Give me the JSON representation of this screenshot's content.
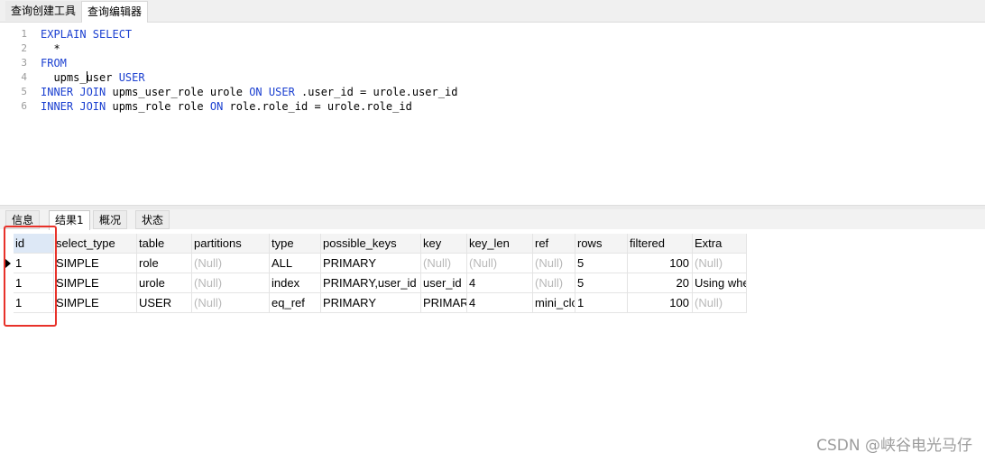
{
  "top_tabs": [
    "查询创建工具",
    "查询编辑器"
  ],
  "editor": {
    "lines": [
      {
        "num": "1",
        "tokens": [
          {
            "t": "EXPLAIN SELECT",
            "k": true
          }
        ]
      },
      {
        "num": "2",
        "tokens": [
          {
            "t": "  *",
            "k": false
          }
        ]
      },
      {
        "num": "3",
        "tokens": [
          {
            "t": "FROM",
            "k": true
          }
        ]
      },
      {
        "num": "4",
        "tokens": [
          {
            "t": "  upms_",
            "k": false
          },
          {
            "t": "|",
            "caret": true
          },
          {
            "t": "user ",
            "k": false
          },
          {
            "t": "USER",
            "k": true
          }
        ]
      },
      {
        "num": "5",
        "tokens": [
          {
            "t": "INNER JOIN",
            "k": true
          },
          {
            "t": " upms_user_role urole ",
            "k": false
          },
          {
            "t": "ON",
            "k": true
          },
          {
            "t": " ",
            "k": false
          },
          {
            "t": "USER",
            "k": true
          },
          {
            "t": " .user_id = urole.user_id",
            "k": false
          }
        ]
      },
      {
        "num": "6",
        "tokens": [
          {
            "t": "INNER JOIN",
            "k": true
          },
          {
            "t": " upms_role role ",
            "k": false
          },
          {
            "t": "ON",
            "k": true
          },
          {
            "t": " role.role_id = urole.role_id",
            "k": false
          }
        ]
      }
    ]
  },
  "bottom_tabs": [
    "信息",
    "结果1",
    "概况",
    "状态"
  ],
  "result": {
    "columns": [
      "id",
      "select_type",
      "table",
      "partitions",
      "type",
      "possible_keys",
      "key",
      "key_len",
      "ref",
      "rows",
      "filtered",
      "Extra"
    ],
    "rows": [
      [
        "1",
        "SIMPLE",
        "role",
        "(Null)",
        "ALL",
        "PRIMARY",
        "(Null)",
        "(Null)",
        "(Null)",
        "5",
        "100",
        "(Null)"
      ],
      [
        "1",
        "SIMPLE",
        "urole",
        "(Null)",
        "index",
        "PRIMARY,user_id",
        "user_id",
        "4",
        "(Null)",
        "5",
        "20",
        "Using where"
      ],
      [
        "1",
        "SIMPLE",
        "USER",
        "(Null)",
        "eq_ref",
        "PRIMARY",
        "PRIMARY",
        "4",
        "mini_clc",
        "1",
        "100",
        "(Null)"
      ]
    ]
  },
  "watermark": "CSDN @峡谷电光马仔",
  "colors": {
    "keyword": "#1a3fd0",
    "annotation": "#e8322a",
    "null_text": "#b8b8b8"
  }
}
